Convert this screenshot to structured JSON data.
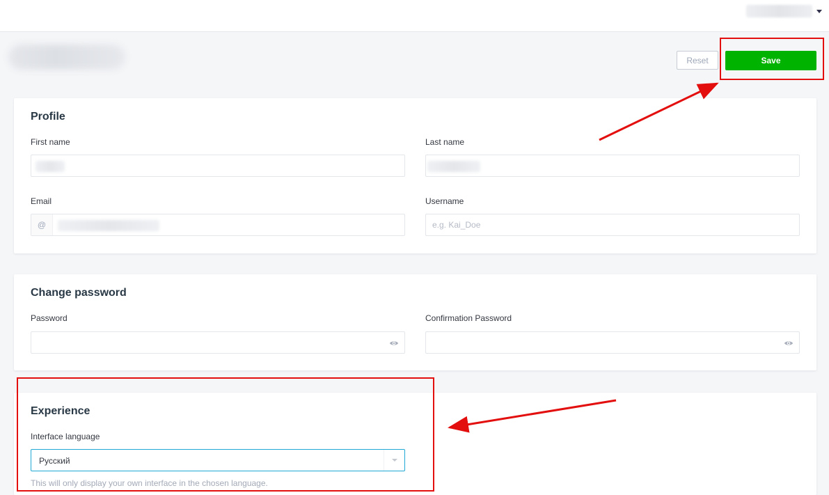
{
  "header": {
    "user_menu_icon": "chevron-down-icon"
  },
  "actions": {
    "reset_label": "Reset",
    "save_label": "Save"
  },
  "profile": {
    "title": "Profile",
    "first_name_label": "First name",
    "last_name_label": "Last name",
    "email_label": "Email",
    "email_prefix": "@",
    "username_label": "Username",
    "username_placeholder": "e.g. Kai_Doe"
  },
  "password": {
    "title": "Change password",
    "password_label": "Password",
    "confirmation_label": "Confirmation Password",
    "visibility_icon": "eye-icon"
  },
  "experience": {
    "title": "Experience",
    "language_label": "Interface language",
    "language_value": "Русский",
    "hint": "This will only display your own interface in the chosen language."
  },
  "colors": {
    "save_button": "#00b300",
    "annotation_red": "#e30e0e",
    "select_focus": "#1fa8d4"
  }
}
